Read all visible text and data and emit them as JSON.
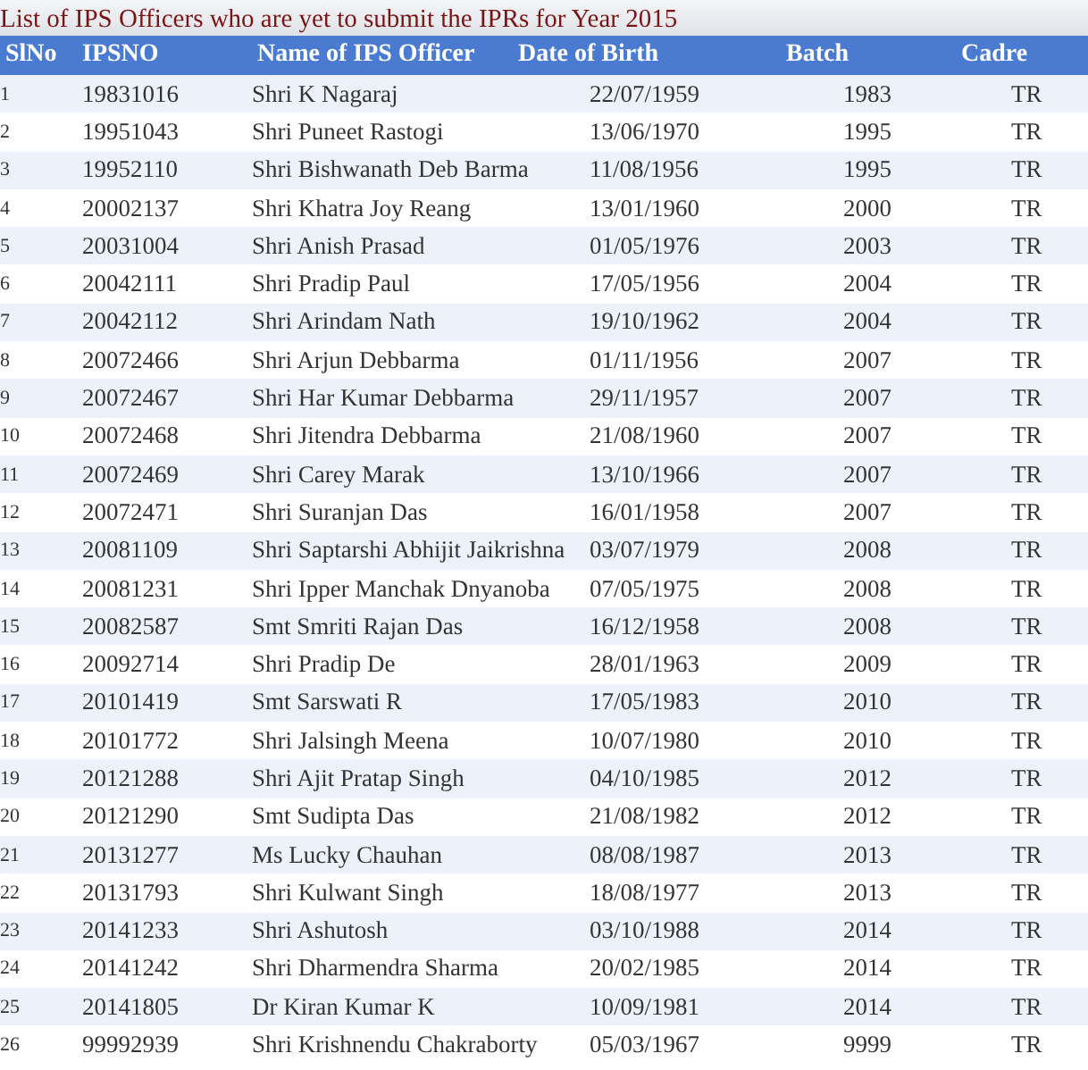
{
  "title": "List of IPS Officers who are yet to submit the IPRs for Year 2015",
  "table": {
    "columns": [
      "SlNo",
      "IPSNO",
      "Name of IPS Officer",
      "Date of Birth",
      "Batch",
      "Cadre"
    ],
    "rows": [
      [
        "1",
        "19831016",
        "Shri K Nagaraj",
        "22/07/1959",
        "1983",
        "TR"
      ],
      [
        "2",
        "19951043",
        "Shri Puneet Rastogi",
        "13/06/1970",
        "1995",
        "TR"
      ],
      [
        "3",
        "19952110",
        "Shri Bishwanath Deb Barma",
        "11/08/1956",
        "1995",
        "TR"
      ],
      [
        "4",
        "20002137",
        "Shri Khatra Joy Reang",
        "13/01/1960",
        "2000",
        "TR"
      ],
      [
        "5",
        "20031004",
        "Shri Anish Prasad",
        "01/05/1976",
        "2003",
        "TR"
      ],
      [
        "6",
        "20042111",
        "Shri Pradip Paul",
        "17/05/1956",
        "2004",
        "TR"
      ],
      [
        "7",
        "20042112",
        "Shri Arindam Nath",
        "19/10/1962",
        "2004",
        "TR"
      ],
      [
        "8",
        "20072466",
        "Shri Arjun Debbarma",
        "01/11/1956",
        "2007",
        "TR"
      ],
      [
        "9",
        "20072467",
        "Shri Har Kumar Debbarma",
        "29/11/1957",
        "2007",
        "TR"
      ],
      [
        "10",
        "20072468",
        "Shri Jitendra Debbarma",
        "21/08/1960",
        "2007",
        "TR"
      ],
      [
        "11",
        "20072469",
        "Shri Carey Marak",
        "13/10/1966",
        "2007",
        "TR"
      ],
      [
        "12",
        "20072471",
        "Shri Suranjan Das",
        "16/01/1958",
        "2007",
        "TR"
      ],
      [
        "13",
        "20081109",
        "Shri Saptarshi Abhijit Jaikrishna",
        "03/07/1979",
        "2008",
        "TR"
      ],
      [
        "14",
        "20081231",
        "Shri Ipper Manchak Dnyanoba",
        "07/05/1975",
        "2008",
        "TR"
      ],
      [
        "15",
        "20082587",
        "Smt Smriti Rajan Das",
        "16/12/1958",
        "2008",
        "TR"
      ],
      [
        "16",
        "20092714",
        "Shri Pradip De",
        "28/01/1963",
        "2009",
        "TR"
      ],
      [
        "17",
        "20101419",
        "Smt Sarswati R",
        "17/05/1983",
        "2010",
        "TR"
      ],
      [
        "18",
        "20101772",
        "Shri Jalsingh Meena",
        "10/07/1980",
        "2010",
        "TR"
      ],
      [
        "19",
        "20121288",
        "Shri Ajit Pratap Singh",
        "04/10/1985",
        "2012",
        "TR"
      ],
      [
        "20",
        "20121290",
        "Smt Sudipta Das",
        "21/08/1982",
        "2012",
        "TR"
      ],
      [
        "21",
        "20131277",
        "Ms Lucky Chauhan",
        "08/08/1987",
        "2013",
        "TR"
      ],
      [
        "22",
        "20131793",
        "Shri Kulwant Singh",
        "18/08/1977",
        "2013",
        "TR"
      ],
      [
        "23",
        "20141233",
        "Shri Ashutosh",
        "03/10/1988",
        "2014",
        "TR"
      ],
      [
        "24",
        "20141242",
        "Shri Dharmendra Sharma",
        "20/02/1985",
        "2014",
        "TR"
      ],
      [
        "25",
        "20141805",
        "Dr Kiran Kumar K",
        "10/09/1981",
        "2014",
        "TR"
      ],
      [
        "26",
        "99992939",
        "Shri Krishnendu Chakraborty",
        "05/03/1967",
        "9999",
        "TR"
      ]
    ]
  }
}
